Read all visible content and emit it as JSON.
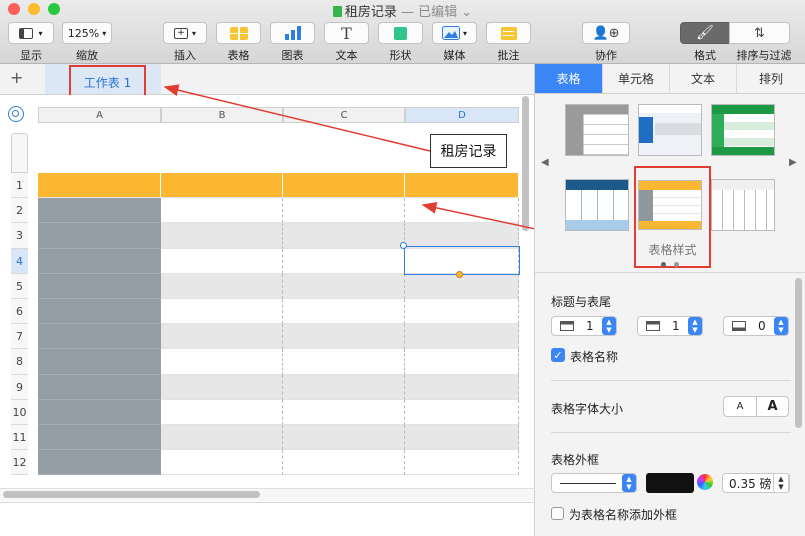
{
  "window": {
    "title": "租房记录",
    "status": "— 已编辑"
  },
  "toolbar": {
    "view": {
      "label": "显示"
    },
    "zoom": {
      "value": "125%",
      "label": "缩放"
    },
    "insert": {
      "label": "插入"
    },
    "table": {
      "label": "表格"
    },
    "chart": {
      "label": "图表"
    },
    "text": {
      "label": "文本"
    },
    "shape": {
      "label": "形状"
    },
    "media": {
      "label": "媒体"
    },
    "comment": {
      "label": "批注"
    },
    "collaborate": {
      "label": "协作"
    },
    "format": {
      "label": "格式"
    },
    "sort_filter": {
      "label": "排序与过滤"
    }
  },
  "sheets": {
    "add_label": "+",
    "tabs": [
      {
        "label": "工作表 1"
      }
    ]
  },
  "table": {
    "columns": [
      "A",
      "B",
      "C",
      "D"
    ],
    "rows": [
      "1",
      "2",
      "3",
      "4",
      "5",
      "6",
      "7",
      "8",
      "9",
      "10",
      "11",
      "12"
    ]
  },
  "annotation": {
    "label": "租房记录"
  },
  "inspector": {
    "tabs": [
      "表格",
      "单元格",
      "文本",
      "排列"
    ],
    "styles_caption": "表格样式",
    "header_footer": {
      "title": "标题与表尾",
      "header_rows": "1",
      "header_cols": "1",
      "footer_rows": "0"
    },
    "table_name": {
      "label": "表格名称",
      "checked": true
    },
    "font_size": {
      "label": "表格字体大小",
      "smaller": "A",
      "larger": "A"
    },
    "outline": {
      "label": "表格外框",
      "width": "0.35 磅",
      "add_label": "为表格名称添加外框"
    }
  },
  "colors": {
    "accent": "#3b86f7",
    "header_orange": "#fbb731",
    "header_gray": "#959ea6",
    "annotation_red": "#e23d33"
  }
}
